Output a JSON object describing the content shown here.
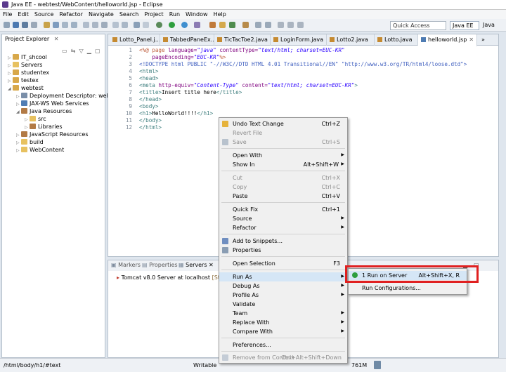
{
  "window": {
    "title": "Java EE - webtest/WebContent/helloworld.jsp - Eclipse"
  },
  "menubar": [
    "File",
    "Edit",
    "Source",
    "Refactor",
    "Navigate",
    "Search",
    "Project",
    "Run",
    "Window",
    "Help"
  ],
  "toolbar": {
    "quick_access_placeholder": "Quick Access",
    "perspectives": {
      "active": "Java EE",
      "other": "Java"
    }
  },
  "explorer": {
    "title": "Project Explorer",
    "tree": [
      {
        "label": "IT_shcool",
        "icon": "project-icon",
        "depth": 0
      },
      {
        "label": "Servers",
        "icon": "folder-icon",
        "depth": 0
      },
      {
        "label": "studentex",
        "icon": "project-icon",
        "depth": 0
      },
      {
        "label": "testex",
        "icon": "project-icon",
        "depth": 0
      },
      {
        "label": "webtest",
        "icon": "project-icon",
        "depth": 0
      },
      {
        "label": "Deployment Descriptor: webtes",
        "icon": "descriptor-icon",
        "depth": 1
      },
      {
        "label": "JAX-WS Web Services",
        "icon": "webservice-icon",
        "depth": 1
      },
      {
        "label": "Java Resources",
        "icon": "java-resources-icon",
        "depth": 1
      },
      {
        "label": "src",
        "icon": "package-folder-icon",
        "depth": 2
      },
      {
        "label": "Libraries",
        "icon": "library-icon",
        "depth": 2
      },
      {
        "label": "JavaScript Resources",
        "icon": "js-resources-icon",
        "depth": 1
      },
      {
        "label": "build",
        "icon": "folder-icon",
        "depth": 1
      },
      {
        "label": "WebContent",
        "icon": "folder-icon",
        "depth": 1
      }
    ]
  },
  "editor": {
    "tabs": [
      {
        "label": "Lotto_Panel.j..."
      },
      {
        "label": "TabbedPaneEx...."
      },
      {
        "label": "TicTacToe2.java"
      },
      {
        "label": "LoginForm.java"
      },
      {
        "label": "Lotto2.java"
      },
      {
        "label": "Lotto.java"
      },
      {
        "label": "helloworld.jsp",
        "active": true
      }
    ],
    "line_numbers": [
      "1",
      "2",
      "3",
      "4",
      "5",
      "6",
      "7",
      "8",
      "9",
      "10",
      "11",
      "12"
    ],
    "code": {
      "l1a": "<%@ page ",
      "l1b": "language=",
      "l1c": "\"java\"",
      "l1d": " contentType=",
      "l1e": "\"text/html; charset=EUC-KR\"",
      "l2a": "    pageEncoding=",
      "l2b": "\"EUC-KR\"",
      "l2c": "%>",
      "l3": "<!DOCTYPE html PUBLIC \"-//W3C//DTD HTML 4.01 Transitional//EN\" \"http://www.w3.org/TR/html4/loose.dtd\">",
      "l4": "<html>",
      "l5": "<head>",
      "l6a": "<meta ",
      "l6b": "http-equiv=",
      "l6c": "\"Content-Type\"",
      "l6d": " content=",
      "l6e": "\"text/html; charset=EUC-KR\"",
      "l6f": ">",
      "l7a": "<title>",
      "l7b": "Insert title here",
      "l7c": "</title>",
      "l8": "</head>",
      "l9": "<body>",
      "l10a": "<h1>",
      "l10b": "HelloWorld!!!!",
      "l10c": "</h1>",
      "l11": "</body>",
      "l12": "</html>"
    }
  },
  "bottom_panel": {
    "tabs": [
      "Markers",
      "Properties",
      "Servers"
    ],
    "server": {
      "name": "Tomcat v8.0 Server at localhost",
      "status": "[Stopp"
    }
  },
  "context_menu": {
    "items": [
      {
        "label": "Undo Text Change",
        "shortcut": "Ctrl+Z"
      },
      {
        "label": "Revert File",
        "shortcut": ""
      },
      {
        "label": "Save",
        "shortcut": "Ctrl+S"
      },
      {
        "label": "Open With",
        "shortcut": ""
      },
      {
        "label": "Show In",
        "shortcut": "Alt+Shift+W"
      },
      {
        "label": "Cut",
        "shortcut": "Ctrl+X"
      },
      {
        "label": "Copy",
        "shortcut": "Ctrl+C"
      },
      {
        "label": "Paste",
        "shortcut": "Ctrl+V"
      },
      {
        "label": "Quick Fix",
        "shortcut": "Ctrl+1"
      },
      {
        "label": "Source",
        "shortcut": ""
      },
      {
        "label": "Refactor",
        "shortcut": ""
      },
      {
        "label": "Add to Snippets...",
        "shortcut": ""
      },
      {
        "label": "Properties",
        "shortcut": ""
      },
      {
        "label": "Open Selection",
        "shortcut": "F3"
      },
      {
        "label": "Run As",
        "shortcut": ""
      },
      {
        "label": "Debug As",
        "shortcut": ""
      },
      {
        "label": "Profile As",
        "shortcut": ""
      },
      {
        "label": "Validate",
        "shortcut": ""
      },
      {
        "label": "Team",
        "shortcut": ""
      },
      {
        "label": "Replace With",
        "shortcut": ""
      },
      {
        "label": "Compare With",
        "shortcut": ""
      },
      {
        "label": "Preferences...",
        "shortcut": ""
      },
      {
        "label": "Remove from Context",
        "shortcut": "Ctrl+Alt+Shift+Down"
      }
    ]
  },
  "run_as_submenu": {
    "items": [
      {
        "label": "1 Run on Server",
        "shortcut": "Alt+Shift+X, R"
      },
      {
        "label": "Run Configurations...",
        "shortcut": ""
      }
    ]
  },
  "statusbar": {
    "path": "/html/body/h1/#text",
    "mode": "Writable",
    "memory": "761M"
  },
  "colors": {
    "highlight_box": "#e02020",
    "menu_hover": "#d5e6f6"
  }
}
